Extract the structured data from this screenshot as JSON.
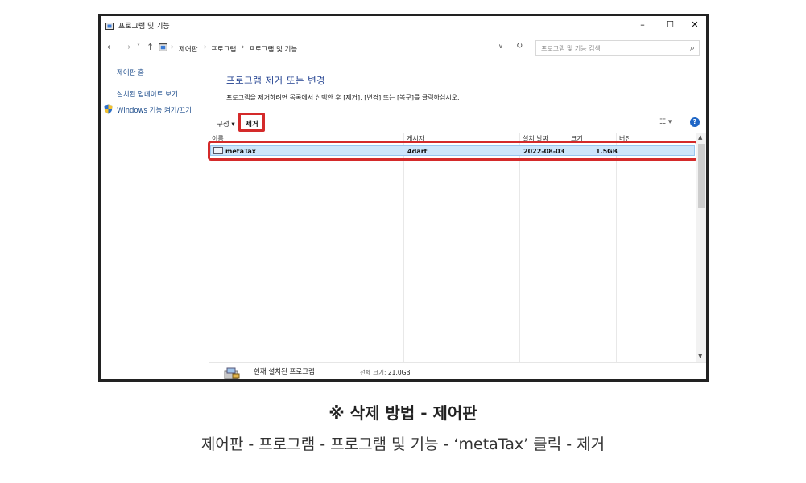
{
  "window": {
    "title": "프로그램 및 기능",
    "minimize": "–",
    "maximize": "☐",
    "close": "✕"
  },
  "address": {
    "back": "←",
    "forward": "→",
    "history": "˅",
    "up": "↑",
    "crumbs": [
      "제어판",
      "프로그램",
      "프로그램 및 기능"
    ],
    "separator": "›",
    "dropdown": "∨",
    "refresh": "↻",
    "search_placeholder": "프로그램 및 기능 검색",
    "search_icon": "⌕"
  },
  "sidebar": {
    "home": "제어판 홈",
    "updates": "설치된 업데이트 보기",
    "features": "Windows 기능 켜기/끄기"
  },
  "main": {
    "heading": "프로그램 제거 또는 변경",
    "description": "프로그램을 제거하려면 목록에서 선택한 후 [제거], [변경] 또는 [복구]를 클릭하십시오."
  },
  "toolbar": {
    "organize": "구성 ▾",
    "remove": "제거",
    "view": "☷ ▾",
    "help": "?"
  },
  "list": {
    "columns": [
      "이름",
      "게시자",
      "설치 날짜",
      "크기",
      "버전"
    ],
    "rows": [
      {
        "name": "metaTax",
        "publisher": "4dart",
        "installed": "2022-08-03",
        "size": "1.5GB",
        "version": ""
      }
    ],
    "scroll_up": "▲",
    "scroll_down": "▼"
  },
  "status": {
    "label": "현재 설치된 프로그램",
    "total_label": "전체 크기:",
    "total_value": "21.0GB"
  },
  "caption": {
    "title": "※ 삭제 방법 - 제어판",
    "steps": "제어판 - 프로그램 - 프로그램 및 기능 - ‘metaTax’ 클릭 - 제거"
  },
  "colors": {
    "highlight": "#d42a2a",
    "selection": "#cde6fb",
    "link": "#1a4a8a",
    "heading": "#1f3f8f"
  }
}
